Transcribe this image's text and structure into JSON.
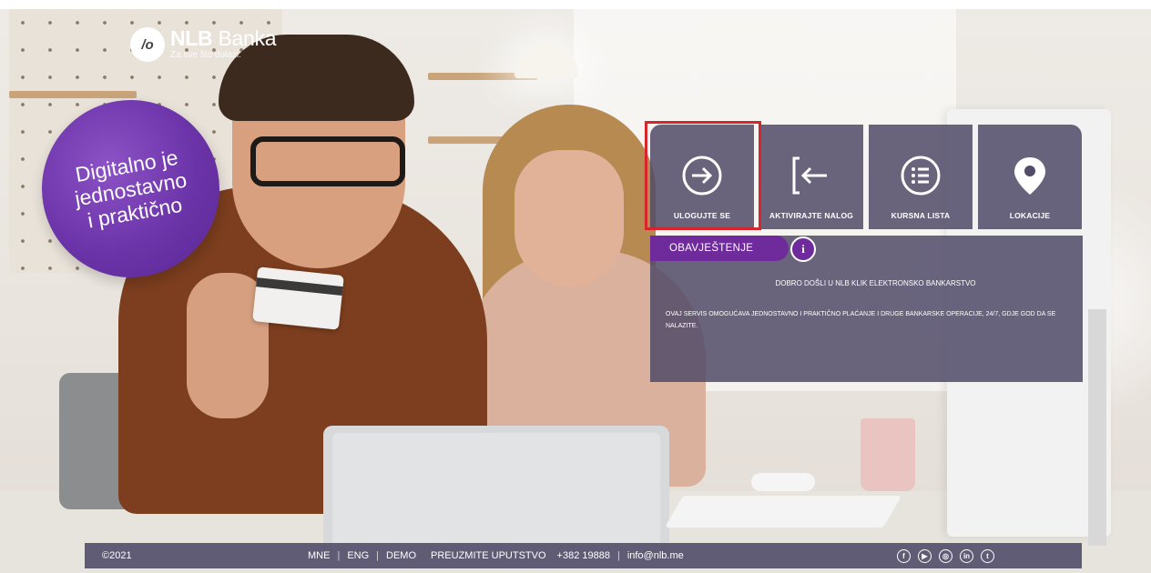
{
  "logo": {
    "name_part1": "NLB",
    "name_part2": "Banka",
    "tagline": "Za sve što dolazi.",
    "mark": "/o"
  },
  "promo": {
    "line1": "Digitalno je",
    "line2": "jednostavno",
    "line3": "i praktično"
  },
  "tiles": [
    {
      "label": "ULOGUJTE SE",
      "icon": "login-arrow-icon",
      "highlighted": true
    },
    {
      "label": "AKTIVIRAJTE NALOG",
      "icon": "activate-arrow-icon"
    },
    {
      "label": "KURSNA LISTA",
      "icon": "list-icon"
    },
    {
      "label": "LOKACIJE",
      "icon": "location-pin-icon"
    }
  ],
  "notice": {
    "tab_label": "OBAVJEŠTENJE",
    "info_glyph": "i",
    "welcome": "DOBRO DOŠLI U NLB KLIK ELEKTRONSKO BANKARSTVO",
    "description": "OVAJ SERVIS OMOGUĆAVA JEDNOSTAVNO I PRAKTIČNO PLAĆANJE I DRUGE BANKARSKE OPERACIJE, 24/7, GDJE GOD DA SE NALAZITE."
  },
  "footer": {
    "copyright": "©2021",
    "links": [
      "MNE",
      "ENG",
      "DEMO",
      "PREUZMITE UPUTSTVO",
      "+382 19888",
      "info@nlb.me"
    ],
    "social": [
      "facebook-icon",
      "youtube-icon",
      "instagram-icon",
      "linkedin-icon",
      "twitter-icon"
    ]
  },
  "colors": {
    "panel": "#524c69",
    "accent_purple": "#6f2a9c",
    "highlight_red": "#d6262b"
  }
}
